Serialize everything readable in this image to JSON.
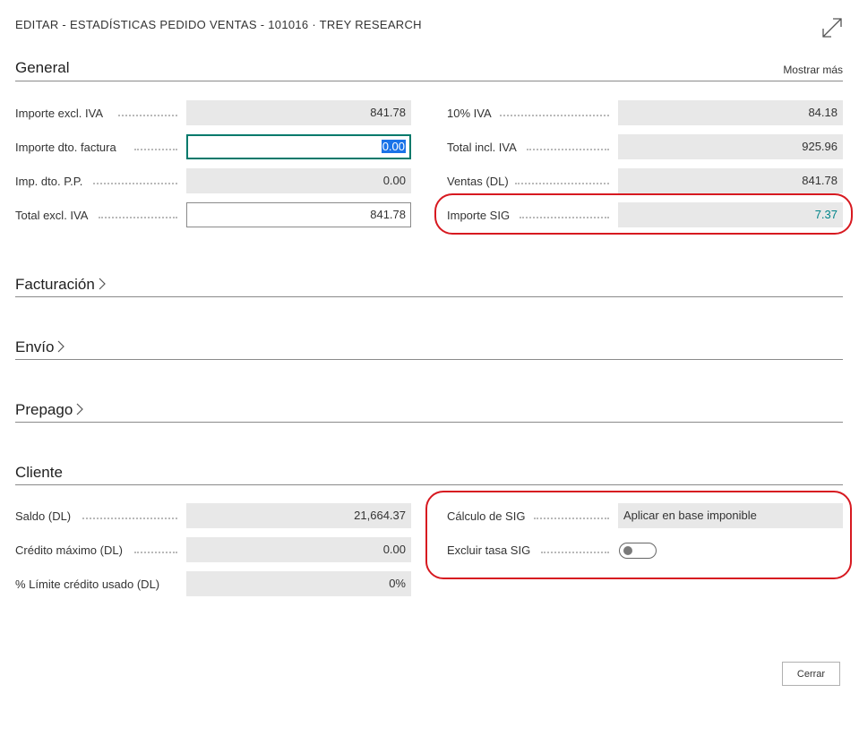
{
  "dialog": {
    "title": "EDITAR - ESTADÍSTICAS PEDIDO VENTAS - 101016 · TREY RESEARCH",
    "expand_icon": "expand-arrows-icon",
    "close_label": "Cerrar"
  },
  "general": {
    "title": "General",
    "show_more": "Mostrar más",
    "left": [
      {
        "label": "Importe excl. IVA",
        "value": "841.78"
      },
      {
        "label": "Importe dto. factura",
        "value": "0.00"
      },
      {
        "label": "Imp. dto. P.P.",
        "value": "0.00"
      },
      {
        "label": "Total excl. IVA",
        "value": "841.78"
      }
    ],
    "right": [
      {
        "label": "10% IVA",
        "value": "84.18"
      },
      {
        "label": "Total incl. IVA",
        "value": "925.96"
      },
      {
        "label": "Ventas (DL)",
        "value": "841.78"
      },
      {
        "label": "Importe SIG",
        "value": "7.37"
      }
    ]
  },
  "sections": {
    "facturacion": "Facturación",
    "envio": "Envío",
    "prepago": "Prepago"
  },
  "cliente": {
    "title": "Cliente",
    "left": [
      {
        "label": "Saldo (DL)",
        "value": "21,664.37"
      },
      {
        "label": "Crédito máximo (DL)",
        "value": "0.00"
      },
      {
        "label": "% Límite crédito usado (DL)",
        "value": "0%"
      }
    ],
    "right": [
      {
        "label": "Cálculo de SIG",
        "value": "Aplicar en base imponible"
      },
      {
        "label": "Excluir tasa SIG",
        "toggle_on": false
      }
    ]
  },
  "colors": {
    "highlight": "#d71920",
    "link": "#008489",
    "focus": "#00796b"
  }
}
